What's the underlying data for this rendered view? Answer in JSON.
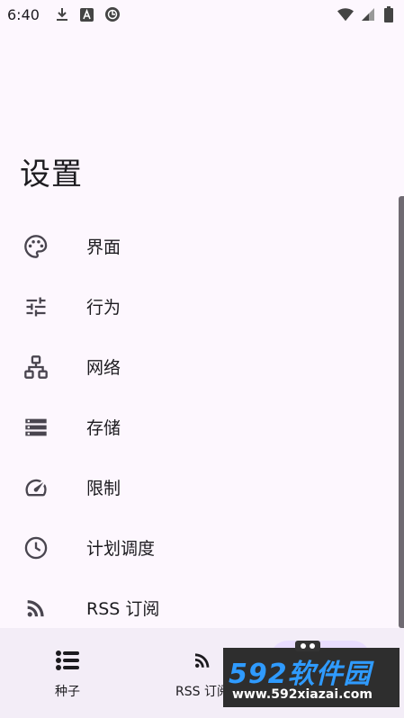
{
  "status_bar": {
    "time": "6:40"
  },
  "page": {
    "title": "设置"
  },
  "settings": [
    {
      "icon": "palette-icon",
      "label": "界面"
    },
    {
      "icon": "tune-icon",
      "label": "行为"
    },
    {
      "icon": "network-icon",
      "label": "网络"
    },
    {
      "icon": "storage-icon",
      "label": "存储"
    },
    {
      "icon": "speedometer-icon",
      "label": "限制"
    },
    {
      "icon": "clock-icon",
      "label": "计划调度"
    },
    {
      "icon": "rss-icon",
      "label": "RSS 订阅"
    }
  ],
  "bottom_nav": {
    "torrents_label": "种子",
    "rss_label": "RSS 订阅"
  },
  "watermark": {
    "brand": "592软件园",
    "url": "www.592xiazai.com"
  },
  "colors": {
    "background": "#fdf7fe",
    "nav_background": "#f3edf7",
    "active_pill": "#e9ddff",
    "icon": "#49454f",
    "watermark_blue": "#2f9bff"
  }
}
